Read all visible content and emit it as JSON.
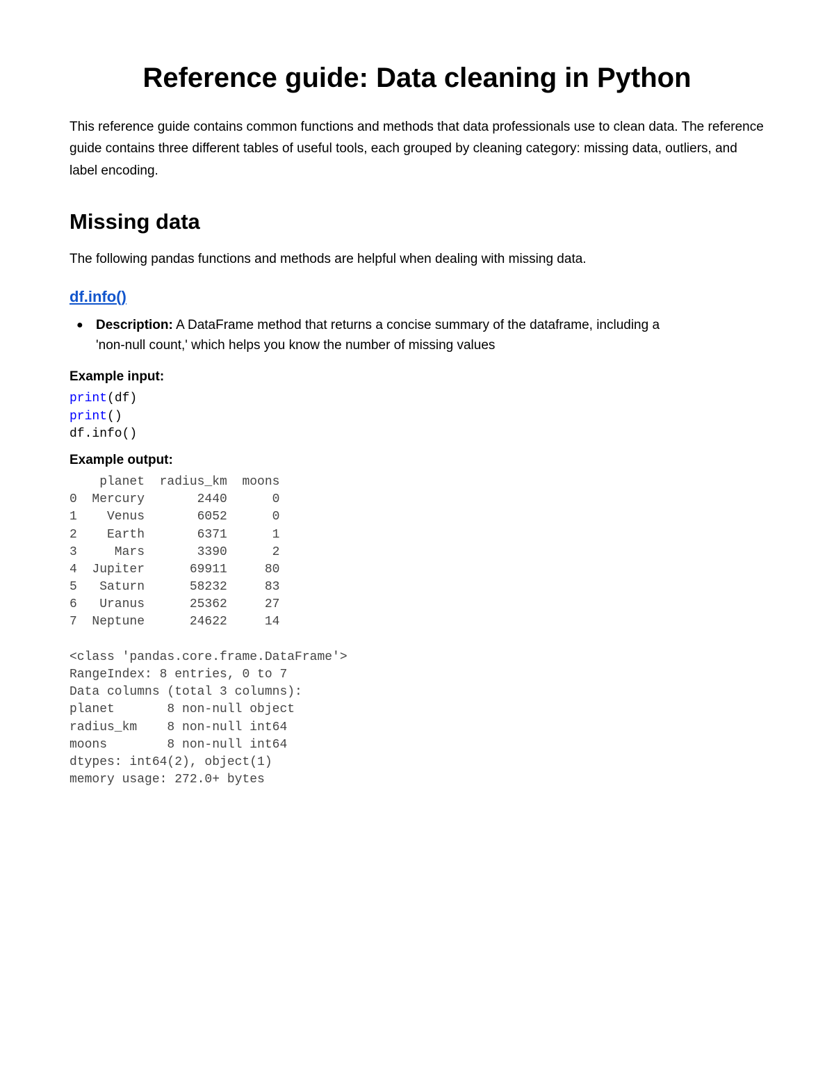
{
  "title": "Reference guide: Data cleaning in Python",
  "intro": "This reference guide contains common functions and methods that data professionals use to clean data. The reference guide contains three different tables of useful tools, each grouped by cleaning category: missing data, outliers, and label encoding.",
  "section": {
    "heading": "Missing data",
    "desc": "The following pandas functions and methods are helpful when dealing with missing data."
  },
  "method": {
    "link_text": "df.info()",
    "desc_label": "Description:",
    "desc_text": "  A DataFrame method that returns a concise summary of the dataframe, including a 'non-null count,' which helps you know the number of missing values"
  },
  "example_input_heading": "Example input:",
  "example_output_heading": "Example output:",
  "code": {
    "kw_print1": "print",
    "after_print1": "(df)",
    "kw_print2": "print",
    "after_print2": "()",
    "line3": "df.info()"
  },
  "output": "    planet  radius_km  moons\n0  Mercury       2440      0\n1    Venus       6052      0\n2    Earth       6371      1\n3     Mars       3390      2\n4  Jupiter      69911     80\n5   Saturn      58232     83\n6   Uranus      25362     27\n7  Neptune      24622     14\n\n<class 'pandas.core.frame.DataFrame'>\nRangeIndex: 8 entries, 0 to 7\nData columns (total 3 columns):\nplanet       8 non-null object\nradius_km    8 non-null int64\nmoons        8 non-null int64\ndtypes: int64(2), object(1)\nmemory usage: 272.0+ bytes"
}
